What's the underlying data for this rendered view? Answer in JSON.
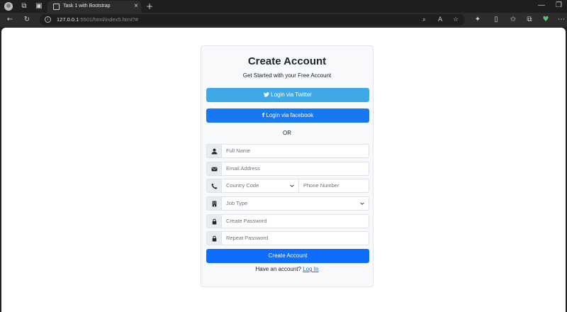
{
  "browser": {
    "tab_title": "Task 1 with Bootstrap",
    "url_host": "127.0.0.1",
    "url_rest": ":5501/html/index5.html?#"
  },
  "form": {
    "title": "Create Account",
    "subtitle": "Get Started with your Free Account",
    "twitter_label": "Login via Twitter",
    "facebook_label": "Login via facebook",
    "or_text": "OR",
    "full_name_placeholder": "Full Name",
    "email_placeholder": "Email Address",
    "country_code_placeholder": "Country Code",
    "phone_placeholder": "Phone Number",
    "job_type_placeholder": "Job Type",
    "password_placeholder": "Create Password",
    "repeat_password_placeholder": "Repeat Password",
    "submit_label": "Create Account",
    "have_account_text": "Have an account?",
    "login_link": "Log In"
  },
  "colors": {
    "twitter": "#3fa9e8",
    "facebook": "#1877f2",
    "primary": "#0d6efd"
  }
}
